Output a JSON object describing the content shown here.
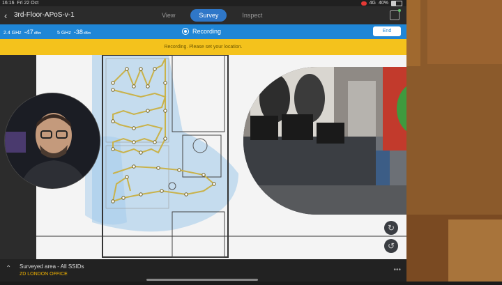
{
  "status": {
    "time": "16:16",
    "date": "Fri 22 Oct",
    "network": "4G",
    "battery": "40%"
  },
  "header": {
    "back_icon": "chevron-left-icon",
    "title": "3rd-Floor-APoS-v-1",
    "tabs": [
      {
        "label": "View",
        "active": false
      },
      {
        "label": "Survey",
        "active": true
      },
      {
        "label": "Inspect",
        "active": false
      }
    ]
  },
  "signal": {
    "band_24": "2.4 GHz",
    "value_24": "-47",
    "band_5": "5 GHz",
    "value_5": "-38",
    "unit": "dBm",
    "recording_label": "Recording",
    "end_label": "End"
  },
  "banner": {
    "text": "Recording. Please set your location."
  },
  "footer": {
    "area_label": "Surveyed area - All SSIDs",
    "office_label": "ZD LONDON OFFICE"
  },
  "colors": {
    "accent": "#1f86d6",
    "warning": "#f4c21c",
    "office": "#f4b400",
    "path": "#c9b24a"
  }
}
